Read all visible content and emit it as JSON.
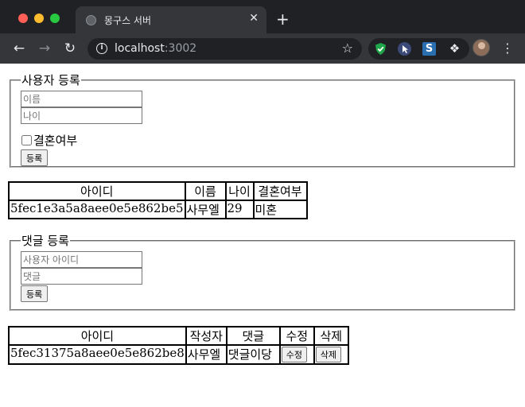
{
  "browser": {
    "tab_title": "몽구스 서버",
    "tab_close": "✕",
    "new_tab": "+",
    "url_host": "localhost",
    "url_port": ":3002",
    "icons": [
      "shield-icon",
      "cursor-extension-icon",
      "s-extension-icon",
      "puzzle-icon",
      "kebab-menu-icon"
    ],
    "ext_s_label": "S"
  },
  "user_form": {
    "legend": "사용자 등록",
    "name_placeholder": "이름",
    "age_placeholder": "나이",
    "married_label": "결혼여부",
    "submit_label": "등록"
  },
  "users_table": {
    "headers": [
      "아이디",
      "이름",
      "나이",
      "결혼여부"
    ],
    "rows": [
      [
        "5fec1e3a5a8aee0e5e862be5",
        "사무엘",
        "29",
        "미혼"
      ]
    ]
  },
  "comment_form": {
    "legend": "댓글 등록",
    "user_id_placeholder": "사용자 아이디",
    "comment_placeholder": "댓글",
    "submit_label": "등록"
  },
  "comments_table": {
    "headers": [
      "아이디",
      "작성자",
      "댓글",
      "수정",
      "삭제"
    ],
    "rows": [
      {
        "id": "5fec31375a8aee0e5e862be8",
        "author": "사무엘",
        "comment": "댓글이당",
        "edit_label": "수정",
        "delete_label": "삭제"
      }
    ]
  },
  "colors": {
    "chrome_bg": "#202124",
    "toolbar_bg": "#35363a",
    "close_dot": "#ff5f57",
    "minimize_dot": "#febc2e",
    "maximize_dot": "#28c840"
  }
}
